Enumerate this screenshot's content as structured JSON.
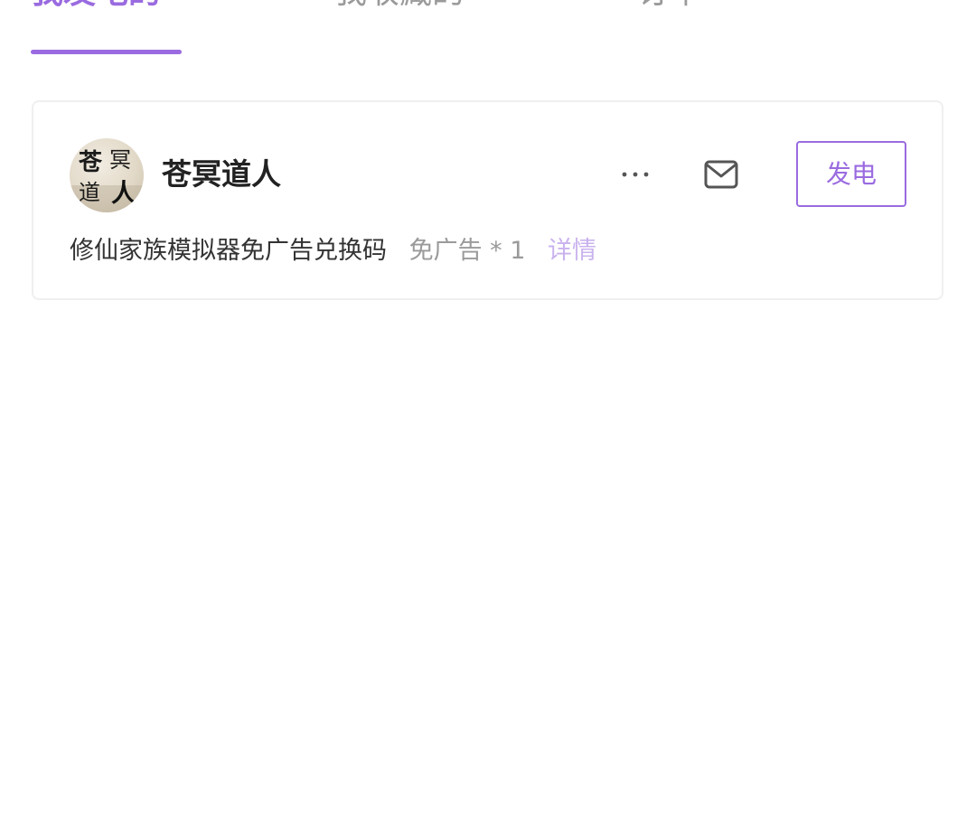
{
  "tabs": [
    {
      "label": "我发电的",
      "active": true
    },
    {
      "label": "我收藏的",
      "active": false
    },
    {
      "label": "订单",
      "active": false
    }
  ],
  "card": {
    "username": "苍冥道人",
    "avatar_text": [
      "苍",
      "冥",
      "道",
      "人"
    ],
    "more_icon": "more-horizontal-icon",
    "mail_icon": "mail-icon",
    "charge_button_label": "发电",
    "item_title": "修仙家族模拟器免广告兑换码",
    "item_quantity": "免广告 * 1",
    "item_detail_label": "详情"
  },
  "colors": {
    "accent": "#9a6be0",
    "accent_light": "#c9b2ee",
    "text_primary": "#222222",
    "text_secondary": "#9a9a9a",
    "card_border": "#efefef"
  }
}
